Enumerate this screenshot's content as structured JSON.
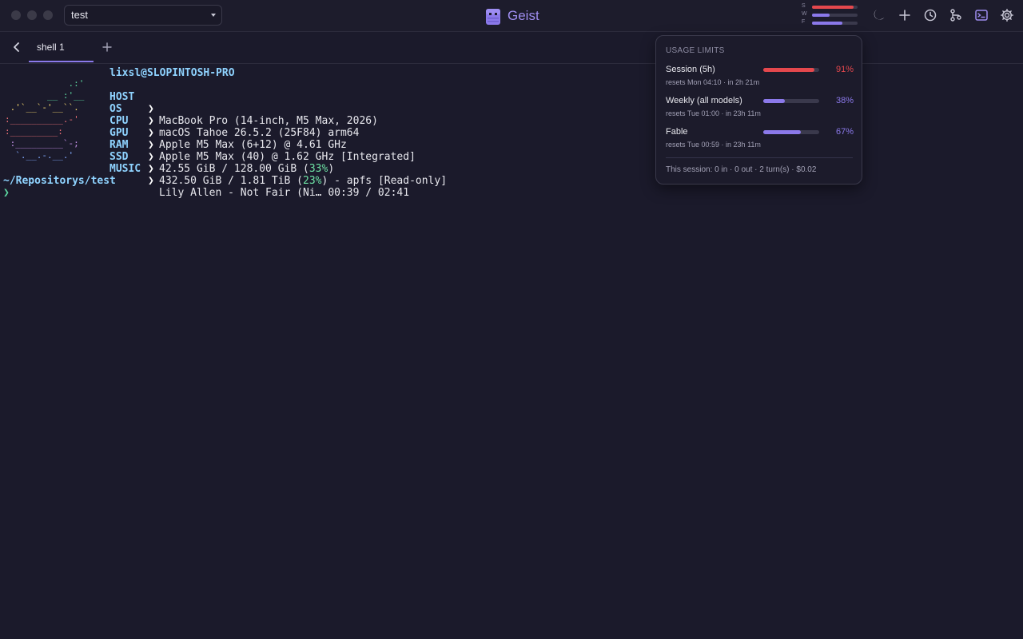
{
  "titlebar": {
    "workspace": "test",
    "app_name": "Geist",
    "mini_usage": [
      {
        "label": "S",
        "percent": 91,
        "color": "#e5484d"
      },
      {
        "label": "W",
        "percent": 38,
        "color": "#8b79ea"
      },
      {
        "label": "F",
        "percent": 67,
        "color": "#8b79ea"
      }
    ],
    "icons": [
      "moon-icon",
      "plus-icon",
      "clock-icon",
      "git-branch-icon",
      "terminal-icon",
      "gear-icon"
    ]
  },
  "tabs": [
    {
      "label": "shell 1",
      "active": true
    }
  ],
  "terminal": {
    "user_host": "lixsl@SLOPINTOSH-PRO",
    "info": [
      {
        "key": "HOST",
        "value": "MacBook Pro (14-inch, M5 Max, 2026)"
      },
      {
        "key": "OS",
        "value": "macOS Tahoe 26.5.2 (25F84) arm64"
      },
      {
        "key": "CPU",
        "value": "Apple M5 Max (6+12) @ 4.61 GHz"
      },
      {
        "key": "GPU",
        "value": "Apple M5 Max (40) @ 1.62 GHz [Integrated]"
      },
      {
        "key": "RAM",
        "value_pre": "42.55 GiB / 128.00 GiB (",
        "value_hl": "33%",
        "value_post": ")"
      },
      {
        "key": "SSD",
        "value_pre": "432.50 GiB / 1.81 TiB (",
        "value_hl": "23%",
        "value_post": ") - apfs [Read-only]"
      },
      {
        "key": "MUSIC",
        "value": "Lily Allen - Not Fair (Ni… 00:39 / 02:41"
      }
    ],
    "separator": "❯",
    "cwd": "~/Repositorys/test",
    "prompt_symbol": "❯"
  },
  "usage_popover": {
    "title": "USAGE LIMITS",
    "limits": [
      {
        "name": "Session (5h)",
        "percent": 91,
        "percent_label": "91%",
        "reset": "resets Mon 04:10 · in 2h 21m",
        "color": "#e5484d"
      },
      {
        "name": "Weekly (all models)",
        "percent": 38,
        "percent_label": "38%",
        "reset": "resets Tue 01:00 · in 23h 11m",
        "color": "#8b79ea"
      },
      {
        "name": "Fable",
        "percent": 67,
        "percent_label": "67%",
        "reset": "resets Tue 00:59 · in 23h 11m",
        "color": "#8b79ea"
      }
    ],
    "footer": "This session: 0 in · 0 out · 2 turn(s) · $0.02"
  }
}
